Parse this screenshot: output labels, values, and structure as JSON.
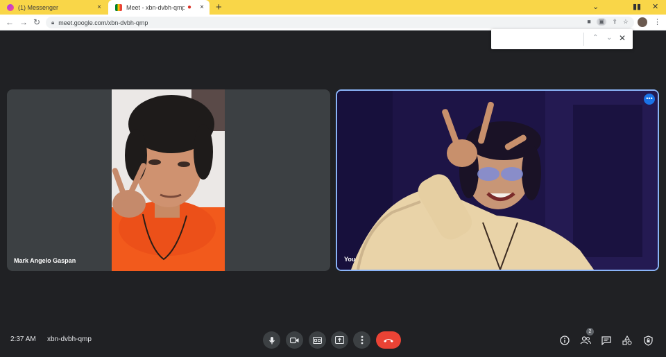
{
  "tabs": [
    {
      "title": "(1) Messenger",
      "close": "×"
    },
    {
      "title": "Meet - xbn-dvbh-qmp",
      "close": "×"
    }
  ],
  "recording_close": "×",
  "new_tab": "+",
  "window_controls": {
    "minimize": "⌄",
    "restore": "▮▮",
    "close": "✕"
  },
  "nav": {
    "back": "←",
    "forward": "→",
    "reload": "↻"
  },
  "address": {
    "url": "meet.google.com/xbn-dvbh-qmp"
  },
  "findbar": {
    "value": "",
    "prev": "⌃",
    "next": "⌄",
    "close": "✕"
  },
  "participants": [
    {
      "name": "Mark Angelo Gaspan"
    },
    {
      "name": "You",
      "more": "•••"
    }
  ],
  "meeting": {
    "time": "2:37 AM",
    "code": "xbn-dvbh-qmp"
  },
  "participant_count": "2",
  "colors": {
    "accent": "#8ab4f8",
    "end_call": "#ea4335",
    "tabbar": "#f9d648",
    "background": "#202124"
  }
}
